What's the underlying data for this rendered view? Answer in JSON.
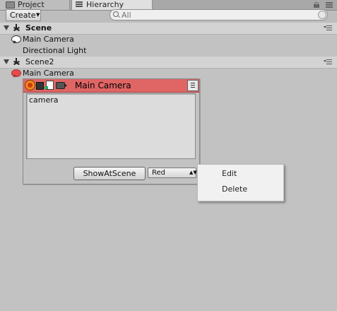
{
  "tabs": [
    {
      "label": "Project",
      "icon": "folder-icon"
    },
    {
      "label": "Hierarchy",
      "icon": "hierarchy-icon"
    }
  ],
  "toolbar": {
    "create_label": "Create",
    "search_placeholder": "All"
  },
  "scenes": [
    {
      "name": "Scene",
      "objects": [
        "Main Camera",
        "Directional Light"
      ]
    },
    {
      "name": "Scene2",
      "objects": [
        "Main Camera"
      ]
    }
  ],
  "popup": {
    "title": "Main Camera",
    "text": "camera",
    "button_label": "ShowAtScene",
    "color_value": "Red",
    "accent_color": "#e06565"
  },
  "context_menu": {
    "items": [
      "Edit",
      "Delete"
    ]
  }
}
